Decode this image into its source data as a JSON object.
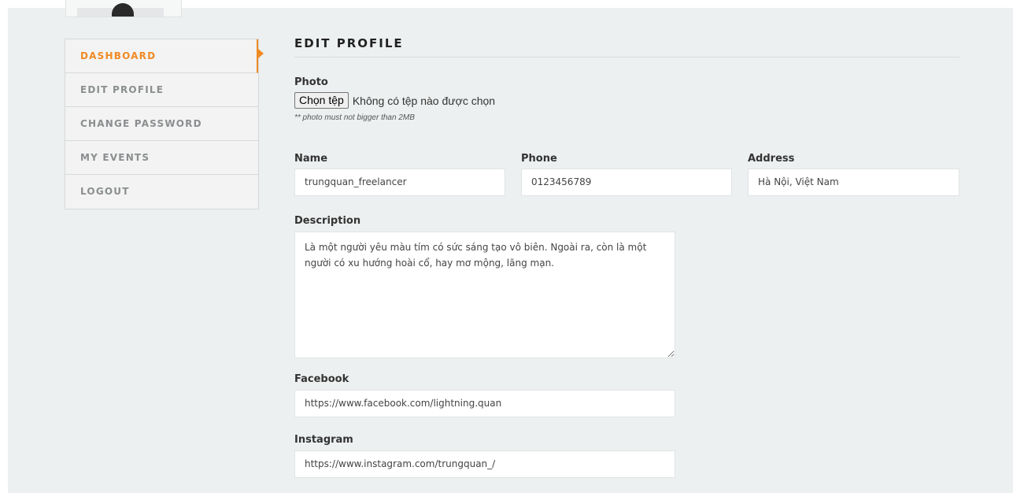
{
  "sidebar": {
    "items": [
      {
        "label": "DASHBOARD",
        "active": true
      },
      {
        "label": "EDIT PROFILE",
        "active": false
      },
      {
        "label": "CHANGE PASSWORD",
        "active": false
      },
      {
        "label": "MY EVENTS",
        "active": false
      },
      {
        "label": "LOGOUT",
        "active": false
      }
    ],
    "accent_color": "#f08a24"
  },
  "main": {
    "title": "EDIT PROFILE",
    "photo": {
      "label": "Photo",
      "button_label": "Chọn tệp",
      "status_text": "Không có tệp nào được chọn",
      "hint": "** photo must not bigger than 2MB"
    },
    "name": {
      "label": "Name",
      "value": "trungquan_freelancer"
    },
    "phone": {
      "label": "Phone",
      "value": "0123456789"
    },
    "address": {
      "label": "Address",
      "value": "Hà Nội, Việt Nam"
    },
    "description": {
      "label": "Description",
      "value": "Là một người yêu màu tím có sức sáng tạo vô biên. Ngoài ra, còn là một người có xu hướng hoài cổ, hay mơ mộng, lãng mạn."
    },
    "facebook": {
      "label": "Facebook",
      "value": "https://www.facebook.com/lightning.quan"
    },
    "instagram": {
      "label": "Instagram",
      "value": "https://www.instagram.com/trungquan_/"
    }
  }
}
